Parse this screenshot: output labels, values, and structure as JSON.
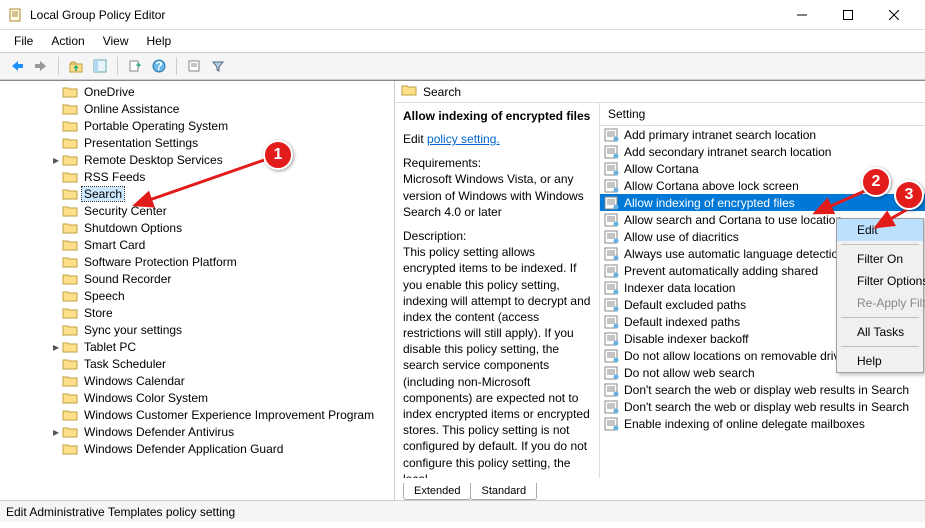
{
  "window": {
    "title": "Local Group Policy Editor"
  },
  "menubar": [
    "File",
    "Action",
    "View",
    "Help"
  ],
  "tree": {
    "items": [
      {
        "label": "OneDrive"
      },
      {
        "label": "Online Assistance"
      },
      {
        "label": "Portable Operating System"
      },
      {
        "label": "Presentation Settings"
      },
      {
        "label": "Remote Desktop Services",
        "expandable": true
      },
      {
        "label": "RSS Feeds"
      },
      {
        "label": "Search",
        "selected": true
      },
      {
        "label": "Security Center"
      },
      {
        "label": "Shutdown Options"
      },
      {
        "label": "Smart Card"
      },
      {
        "label": "Software Protection Platform"
      },
      {
        "label": "Sound Recorder"
      },
      {
        "label": "Speech"
      },
      {
        "label": "Store"
      },
      {
        "label": "Sync your settings"
      },
      {
        "label": "Tablet PC",
        "expandable": true
      },
      {
        "label": "Task Scheduler"
      },
      {
        "label": "Windows Calendar"
      },
      {
        "label": "Windows Color System"
      },
      {
        "label": "Windows Customer Experience Improvement Program"
      },
      {
        "label": "Windows Defender Antivirus",
        "expandable": true
      },
      {
        "label": "Windows Defender Application Guard"
      }
    ]
  },
  "right": {
    "location": "Search",
    "heading": "Allow indexing of encrypted files",
    "edit_link_prefix": "Edit ",
    "edit_link": "policy setting.",
    "requirements_label": "Requirements:",
    "requirements": "Microsoft Windows Vista, or any version of Windows with Windows Search 4.0 or later",
    "description_label": "Description:",
    "description": "This policy setting allows encrypted items to be indexed. If you enable this policy setting, indexing  will attempt to decrypt and index the content (access restrictions will still apply). If you disable this policy setting, the search service components (including non-Microsoft components) are expected not to index encrypted items or encrypted stores. This policy setting is not configured by default. If you do not configure this policy setting, the local",
    "settings_header": "Setting",
    "settings": [
      "Add primary intranet search location",
      "Add secondary intranet search location",
      "Allow Cortana",
      "Allow Cortana above lock screen",
      "Allow indexing of encrypted files",
      "Allow search and Cortana to use location",
      "Allow use of diacritics",
      "Always use automatic language detection",
      "Prevent automatically adding shared",
      "Indexer data location",
      "Default excluded paths",
      "Default indexed paths",
      "Disable indexer backoff",
      "Do not allow locations on removable drives to be added",
      "Do not allow web search",
      "Don't search the web or display web results in Search",
      "Don't search the web or display web results in Search",
      "Enable indexing of online delegate mailboxes"
    ],
    "selected_setting_index": 4,
    "tabs": {
      "extended": "Extended",
      "standard": "Standard"
    }
  },
  "contextmenu": {
    "items": [
      {
        "label": "Edit",
        "hover": true
      },
      {
        "sep": true
      },
      {
        "label": "Filter On"
      },
      {
        "label": "Filter Options..."
      },
      {
        "label": "Re-Apply Filter",
        "disabled": true
      },
      {
        "sep": true
      },
      {
        "label": "All Tasks"
      },
      {
        "sep": true
      },
      {
        "label": "Help"
      }
    ]
  },
  "statusbar": "Edit Administrative Templates policy setting",
  "markers": {
    "m1": "1",
    "m2": "2",
    "m3": "3"
  }
}
